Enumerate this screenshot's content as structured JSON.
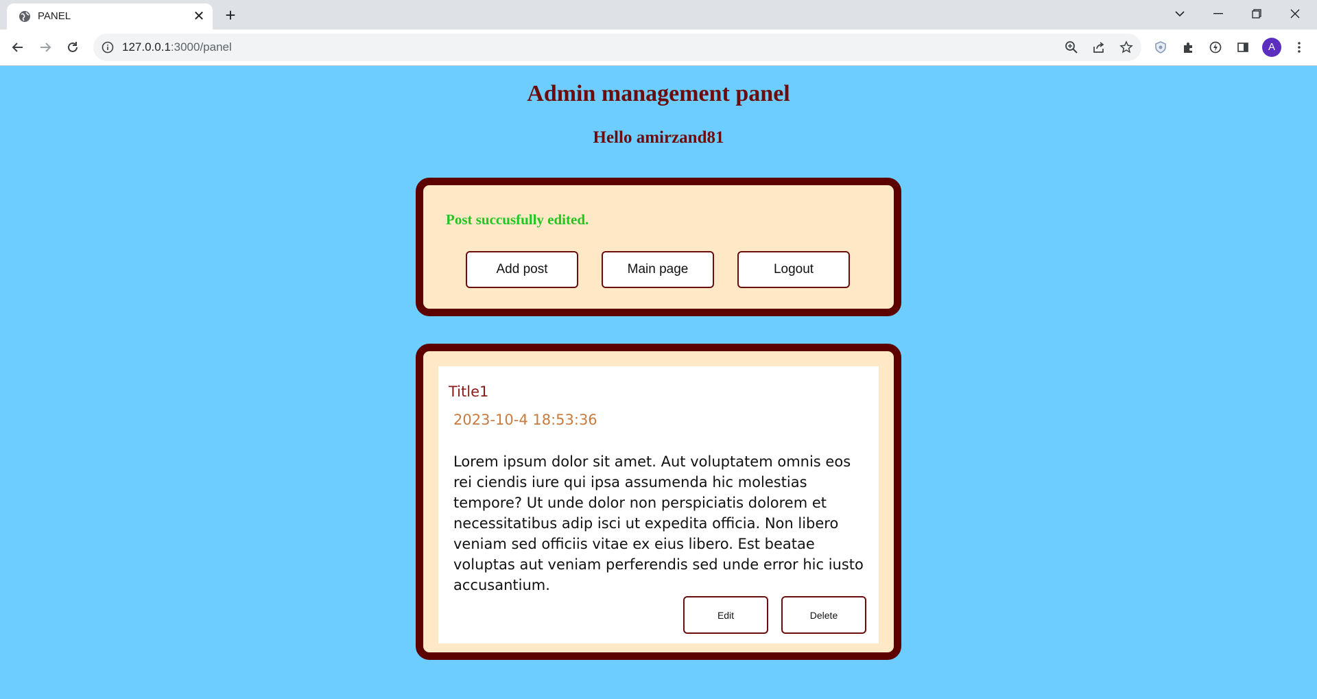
{
  "browser": {
    "tab_title": "PANEL",
    "url_host": "127.0.0.1",
    "url_path": ":3000/panel",
    "avatar_letter": "A"
  },
  "page": {
    "title": "Admin management panel",
    "greeting": "Hello amirzand81"
  },
  "status": {
    "message": "Post succusfully edited.",
    "color": "#22c522"
  },
  "actions": {
    "add_post": "Add post",
    "main_page": "Main page",
    "logout": "Logout"
  },
  "posts": [
    {
      "title": "Title1",
      "date": "2023-10-4 18:53:36",
      "body": "Lorem ipsum dolor sit amet. Aut voluptatem omnis eos rei ciendis iure qui ipsa assumenda hic molestias tempore? Ut unde dolor non perspiciatis dolorem et necessitatibus adip isci ut expedita officia. Non libero veniam sed officiis vitae ex eius libero. Est beatae voluptas aut veniam perferendis sed unde error hic iusto accusantium.",
      "edit_label": "Edit",
      "delete_label": "Delete"
    }
  ],
  "colors": {
    "page_background": "#6dcdff",
    "panel_border": "#5c0000",
    "panel_fill": "#ffe8c6",
    "heading": "#6b0d0d"
  }
}
